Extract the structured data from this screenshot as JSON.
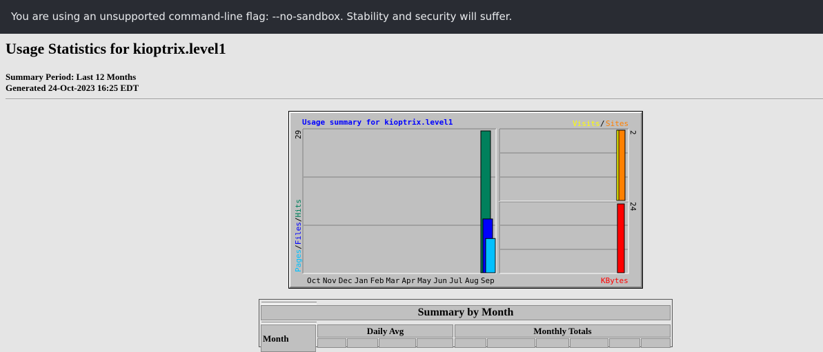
{
  "infobar": {
    "message": "You are using an unsupported command-line flag: --no-sandbox. Stability and security will suffer."
  },
  "page": {
    "title": "Usage Statistics for kioptrix.level1",
    "summary_period": "Summary Period: Last 12 Months",
    "generated": "Generated 24-Oct-2023 16:25 EDT"
  },
  "chart": {
    "title": "Usage summary for kioptrix.level1",
    "legend_visits": "Visits",
    "legend_slash": "/",
    "legend_sites": "Sites",
    "y_left_max": "29",
    "y_visits_max": "2",
    "y_kbytes_max": "24",
    "left_legend_pages": "Pages",
    "left_legend_files": "Files",
    "left_legend_hits": "Hits",
    "kbytes_label": "KBytes",
    "colors": {
      "hits": "#00805c",
      "files": "#0000ff",
      "pages": "#00c0ff",
      "visits": "#ffff00",
      "sites": "#ff8000",
      "kbytes": "#ff0000",
      "title": "#0000ff",
      "background": "#c0c0c0"
    }
  },
  "chart_data": {
    "type": "bar",
    "categories": [
      "Oct",
      "Nov",
      "Dec",
      "Jan",
      "Feb",
      "Mar",
      "Apr",
      "May",
      "Jun",
      "Jul",
      "Aug",
      "Sep"
    ],
    "series": [
      {
        "name": "Hits",
        "values": [
          0,
          0,
          0,
          0,
          0,
          0,
          0,
          0,
          0,
          0,
          0,
          29
        ]
      },
      {
        "name": "Files",
        "values": [
          0,
          0,
          0,
          0,
          0,
          0,
          0,
          0,
          0,
          0,
          0,
          11
        ]
      },
      {
        "name": "Pages",
        "values": [
          0,
          0,
          0,
          0,
          0,
          0,
          0,
          0,
          0,
          0,
          0,
          7
        ]
      },
      {
        "name": "Visits",
        "values": [
          0,
          0,
          0,
          0,
          0,
          0,
          0,
          0,
          0,
          0,
          0,
          2
        ]
      },
      {
        "name": "Sites",
        "values": [
          0,
          0,
          0,
          0,
          0,
          0,
          0,
          0,
          0,
          0,
          0,
          2
        ]
      },
      {
        "name": "KBytes",
        "values": [
          0,
          0,
          0,
          0,
          0,
          0,
          0,
          0,
          0,
          0,
          0,
          24
        ]
      }
    ],
    "title": "Usage summary for kioptrix.level1",
    "ylim_hits": [
      0,
      29
    ],
    "ylim_visits": [
      0,
      2
    ],
    "ylim_kbytes": [
      0,
      24
    ]
  },
  "table": {
    "title": "Summary by Month",
    "month_header": "Month",
    "daily_avg_header": "Daily Avg",
    "monthly_totals_header": "Monthly Totals"
  }
}
